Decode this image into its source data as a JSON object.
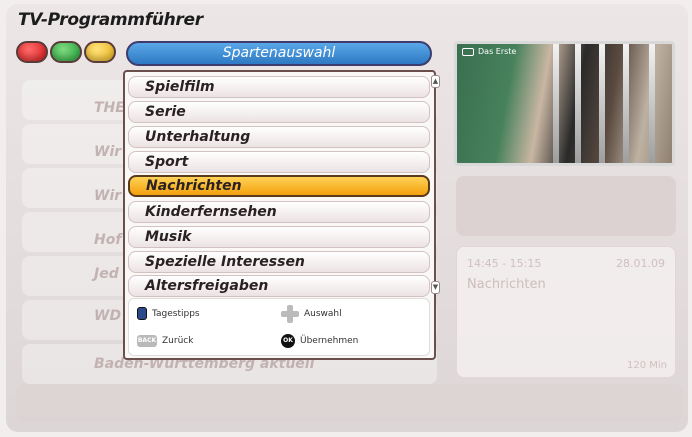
{
  "app": {
    "title": "TV-Programmführer"
  },
  "color_keys": [
    "red",
    "green",
    "yellow"
  ],
  "header": {
    "title": "Spartenauswahl"
  },
  "background_list": [
    {
      "num": "",
      "text": "THE"
    },
    {
      "num": "",
      "text": "Wir"
    },
    {
      "num": "",
      "text": "Wir"
    },
    {
      "num": "",
      "text": "Hof"
    },
    {
      "num": "",
      "text": "Jed"
    },
    {
      "num": "",
      "text": "WD"
    },
    {
      "num": "",
      "text": "Baden-Württemberg aktuell"
    }
  ],
  "menu": {
    "items": [
      {
        "label": "Spielfilm"
      },
      {
        "label": "Serie"
      },
      {
        "label": "Unterhaltung"
      },
      {
        "label": "Sport"
      },
      {
        "label": "Nachrichten",
        "selected": true
      },
      {
        "label": "Kinderfernsehen"
      },
      {
        "label": "Musik"
      },
      {
        "label": "Spezielle Interessen"
      },
      {
        "label": "Altersfreigaben"
      }
    ],
    "scroll_up_icon": "chevron-up-icon",
    "scroll_down_icon": "chevron-down-icon"
  },
  "hints": {
    "tagestipps": "Tagestipps",
    "auswahl": "Auswahl",
    "zurueck": "Zurück",
    "uebernehmen": "Übernehmen",
    "back_key": "BACK",
    "ok_key": "OK"
  },
  "preview": {
    "channel": "Das Erste"
  },
  "info": {
    "time": "14:45 - 15:15",
    "date": "28.01.09",
    "title": "Nachrichten",
    "duration": "120 Min"
  },
  "colors": {
    "accent_blue": "#2d79c3",
    "selection_orange": "#f3a00e",
    "red_key": "#d61a1a",
    "green_key": "#23a33b",
    "yellow_key": "#e8b21d"
  }
}
